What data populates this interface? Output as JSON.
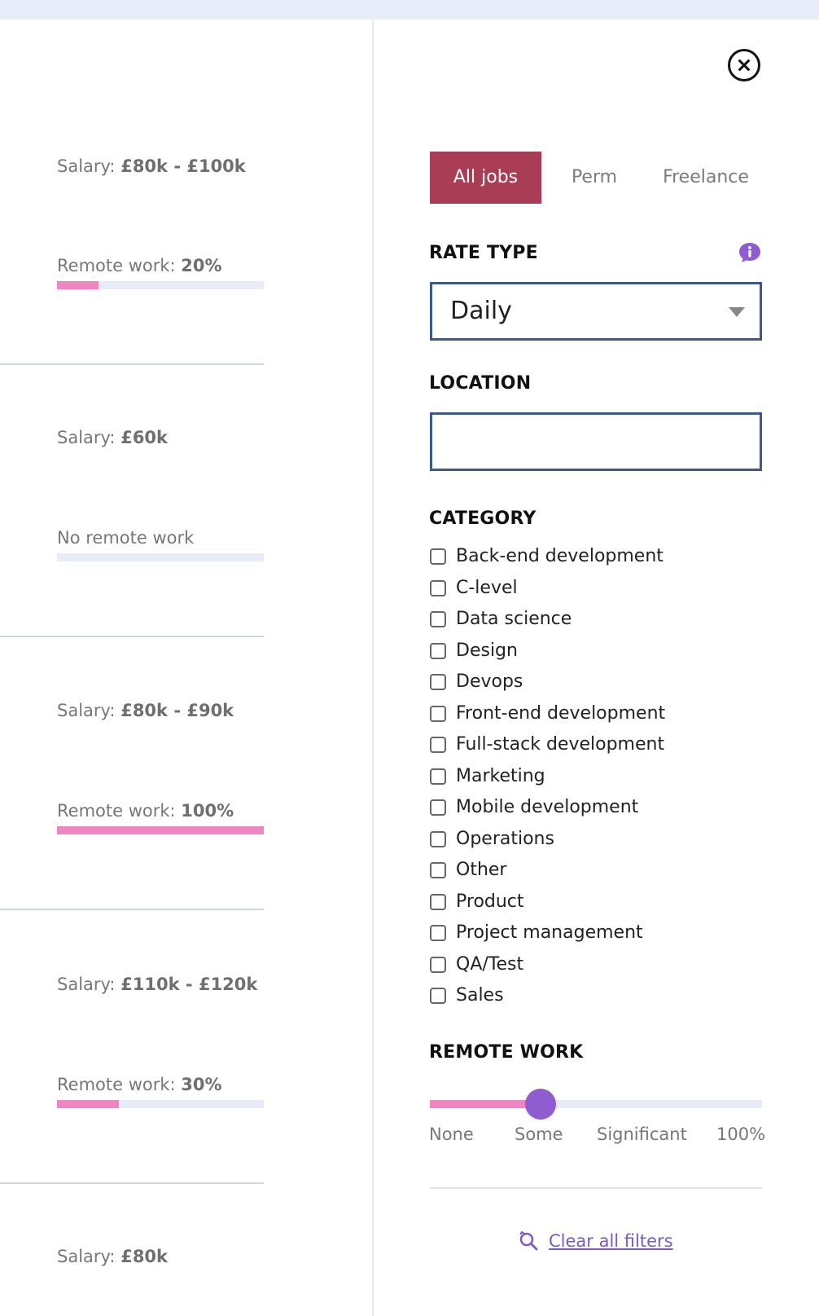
{
  "jobs": [
    {
      "salary_label": "Salary:",
      "salary": "£80k - £100k",
      "remote_label": "Remote work:",
      "remote_value": "20%",
      "remote_fraction": 0.2
    },
    {
      "salary_label": "Salary:",
      "salary": "£60k",
      "remote_text": "No remote work",
      "remote_fraction": 0.0
    },
    {
      "salary_label": "Salary:",
      "salary": "£80k - £90k",
      "remote_label": "Remote work:",
      "remote_value": "100%",
      "remote_fraction": 1.0
    },
    {
      "salary_label": "Salary:",
      "salary": "£110k - £120k",
      "remote_label": "Remote work:",
      "remote_value": "30%",
      "remote_fraction": 0.3
    },
    {
      "salary_label": "Salary:",
      "salary": "£80k"
    }
  ],
  "filters": {
    "tabs": [
      {
        "label": "All jobs",
        "active": true
      },
      {
        "label": "Perm",
        "active": false
      },
      {
        "label": "Freelance",
        "active": false
      }
    ],
    "rate_type": {
      "title": "RATE TYPE",
      "value": "Daily",
      "info_icon": "info-icon"
    },
    "location": {
      "title": "LOCATION",
      "value": "",
      "placeholder": ""
    },
    "category": {
      "title": "CATEGORY",
      "items": [
        "Back-end development",
        "C-level",
        "Data science",
        "Design",
        "Devops",
        "Front-end development",
        "Full-stack development",
        "Marketing",
        "Mobile development",
        "Operations",
        "Other",
        "Product",
        "Project management",
        "QA/Test",
        "Sales"
      ]
    },
    "remote_work": {
      "title": "REMOTE WORK",
      "labels": [
        "None",
        "Some",
        "Significant",
        "100%"
      ],
      "selected_label": "Some"
    },
    "clear_label": "Clear all filters"
  },
  "colors": {
    "accent": "#a83d55",
    "remote_bar": "#ef86c1",
    "bar_track": "#e7ecf8",
    "slider_thumb": "#8f5dcf",
    "input_border": "#3b5a85",
    "link": "#7a5cc0",
    "topbar": "#e8edf9"
  }
}
